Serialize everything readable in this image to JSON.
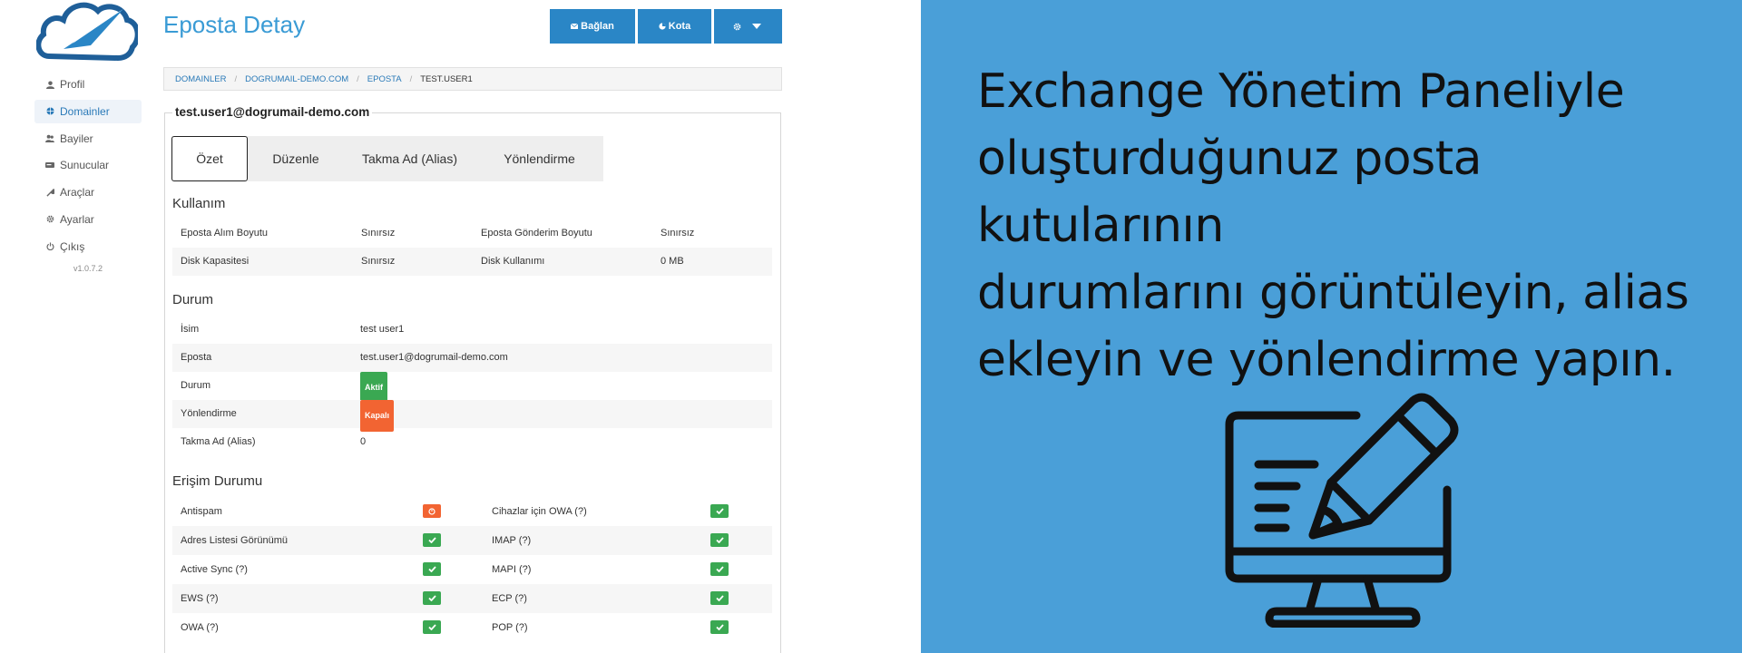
{
  "app": {
    "page_title": "Eposta Detay",
    "sidebar": {
      "items": [
        {
          "label": "Profil",
          "icon": "user-icon"
        },
        {
          "label": "Domainler",
          "icon": "globe-icon"
        },
        {
          "label": "Bayiler",
          "icon": "users-icon"
        },
        {
          "label": "Sunucular",
          "icon": "server-icon"
        },
        {
          "label": "Araçlar",
          "icon": "wrench-icon"
        },
        {
          "label": "Ayarlar",
          "icon": "gear-icon"
        },
        {
          "label": "Çıkış",
          "icon": "power-icon"
        }
      ],
      "active_index": 1,
      "version": "v1.0.7.2"
    },
    "toolbar": {
      "connect_label": "Bağlan",
      "quota_label": "Kota",
      "settings_icon": "gear-icon",
      "dropdown_icon": "caret-down-icon"
    },
    "breadcrumb": {
      "items": [
        "DOMAINLER",
        "DOGRUMAIL-DEMO.COM",
        "EPOSTA"
      ],
      "current": "TEST.USER1"
    },
    "panel_title": "test.user1@dogrumail-demo.com",
    "tabs": [
      "Özet",
      "Düzenle",
      "Takma Ad (Alias)",
      "Yönlendirme"
    ],
    "active_tab": 0,
    "usage": {
      "title": "Kullanım",
      "rows": [
        {
          "label1": "Eposta Alım Boyutu",
          "value1": "Sınırsız",
          "label2": "Eposta Gönderim Boyutu",
          "value2": "Sınırsız"
        },
        {
          "label1": "Disk Kapasitesi",
          "value1": "Sınırsız",
          "label2": "Disk Kullanımı",
          "value2": "0 MB"
        }
      ]
    },
    "status": {
      "title": "Durum",
      "name_label": "İsim",
      "name_value": "test user1",
      "email_label": "Eposta",
      "email_value": "test.user1@dogrumail-demo.com",
      "state_label": "Durum",
      "state_badge": "Aktif",
      "forward_label": "Yönlendirme",
      "forward_badge": "Kapalı",
      "alias_label": "Takma Ad (Alias)",
      "alias_value": "0"
    },
    "access": {
      "title": "Erişim Durumu",
      "rows": [
        {
          "left": "Antispam",
          "left_state": "off",
          "right": "Cihazlar için OWA (?)",
          "right_state": "on"
        },
        {
          "left": "Adres Listesi Görünümü",
          "left_state": "on",
          "right": "IMAP (?)",
          "right_state": "on"
        },
        {
          "left": "Active Sync (?)",
          "left_state": "on",
          "right": "MAPI (?)",
          "right_state": "on"
        },
        {
          "left": "EWS (?)",
          "left_state": "on",
          "right": "ECP (?)",
          "right_state": "on"
        },
        {
          "left": "OWA (?)",
          "left_state": "on",
          "right": "POP (?)",
          "right_state": "on"
        }
      ]
    },
    "colors": {
      "accent": "#2a86c6",
      "title_blue": "#3a9bd5",
      "success": "#3aa852",
      "danger": "#f26432"
    }
  },
  "promo": {
    "lines": [
      "Exchange Yönetim Paneliyle",
      "oluşturduğunuz posta kutularının",
      "durumlarını görüntüleyin, alias",
      "ekleyin ve yönlendirme yapın."
    ],
    "illustration_icon": "monitor-pencil-icon",
    "background": "#4a9fd8"
  }
}
